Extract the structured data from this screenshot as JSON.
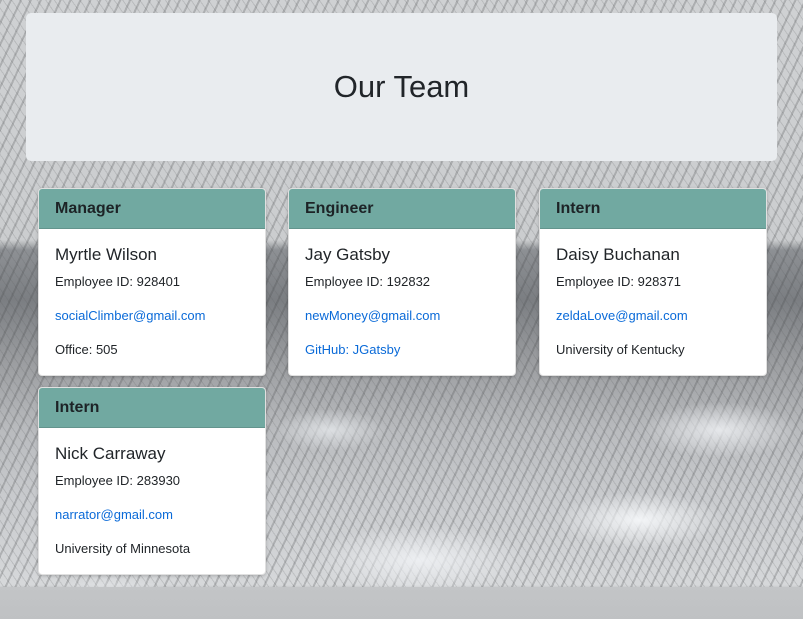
{
  "page": {
    "title": "Our Team"
  },
  "employees": [
    {
      "role": "Manager",
      "name": "Myrtle Wilson",
      "id_text": "Employee ID: 928401",
      "email": "socialClimber@gmail.com",
      "extra": "Office: 505",
      "extra_is_link": false
    },
    {
      "role": "Engineer",
      "name": "Jay Gatsby",
      "id_text": "Employee ID: 192832",
      "email": "newMoney@gmail.com",
      "extra": "GitHub: JGatsby",
      "extra_is_link": true
    },
    {
      "role": "Intern",
      "name": "Daisy Buchanan",
      "id_text": "Employee ID: 928371",
      "email": "zeldaLove@gmail.com",
      "extra": "University of Kentucky",
      "extra_is_link": false
    },
    {
      "role": "Intern",
      "name": "Nick Carraway",
      "id_text": "Employee ID: 283930",
      "email": "narrator@gmail.com",
      "extra": "University of Minnesota",
      "extra_is_link": false
    }
  ],
  "colors": {
    "header_bg": "#71a9a1",
    "link": "#0a6ad8",
    "jumbotron": "#e9ecef"
  }
}
